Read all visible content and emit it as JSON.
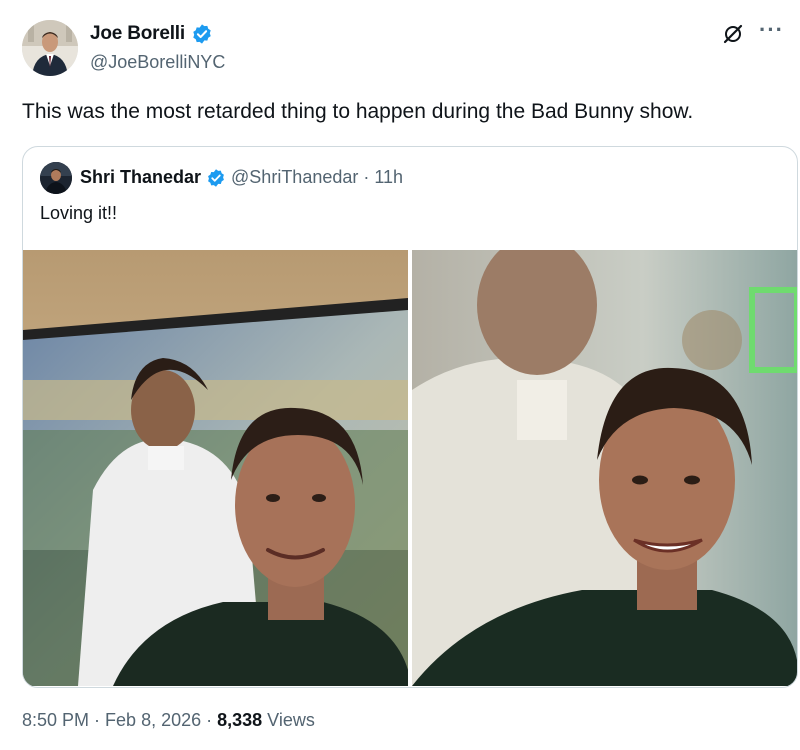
{
  "author": {
    "display_name": "Joe Borelli",
    "handle": "@JoeBorelliNYC",
    "verified": true,
    "avatar_icon": "profile-photo-man-in-suit"
  },
  "tweet": {
    "text": "This was the most retarded thing to happen during the Bad Bunny show."
  },
  "icons": {
    "grok": "grok-icon",
    "more": "more-horizontal-icon",
    "verified": "verified-badge-icon"
  },
  "quote": {
    "display_name": "Shri Thanedar",
    "handle": "@ShriThanedar",
    "separator": "·",
    "time": "11h",
    "text": "Loving it!!",
    "images": [
      {
        "name": "selfie-with-tv-left"
      },
      {
        "name": "selfie-with-tv-right"
      }
    ]
  },
  "meta": {
    "time": "8:50 PM",
    "separator": "·",
    "date": "Feb 8, 2026",
    "views_count": "8,338",
    "views_label": "Views"
  },
  "colors": {
    "verified_blue": "#1d9bf0",
    "text_primary": "#0f1419",
    "text_secondary": "#536471",
    "border": "#cfd9de"
  }
}
